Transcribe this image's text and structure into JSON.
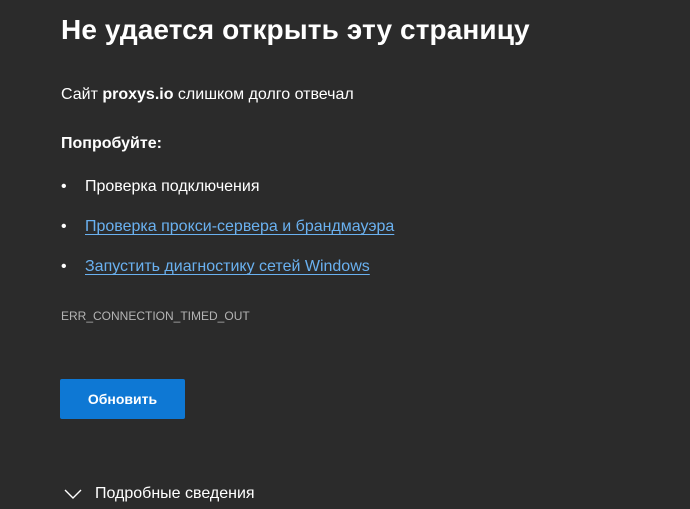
{
  "error_page": {
    "title": "Не удается открыть эту страницу",
    "subtitle_prefix": "Сайт ",
    "site": "proxys.io",
    "subtitle_suffix": " слишком долго отвечал",
    "try_heading": "Попробуйте:",
    "suggestions": [
      {
        "label": "Проверка подключения",
        "is_link": false
      },
      {
        "label": "Проверка прокси-сервера и брандмауэра",
        "is_link": true
      },
      {
        "label": "Запустить диагностику сетей Windows",
        "is_link": true
      }
    ],
    "error_code": "ERR_CONNECTION_TIMED_OUT",
    "reload_button_label": "Обновить",
    "details_label": "Подробные сведения",
    "details_icon": "chevron-down-icon"
  },
  "colors": {
    "background": "#2b2b2b",
    "text": "#ffffff",
    "link": "#6ab1f0",
    "error_code": "#b4b4b4",
    "button": "#0e78d4"
  }
}
